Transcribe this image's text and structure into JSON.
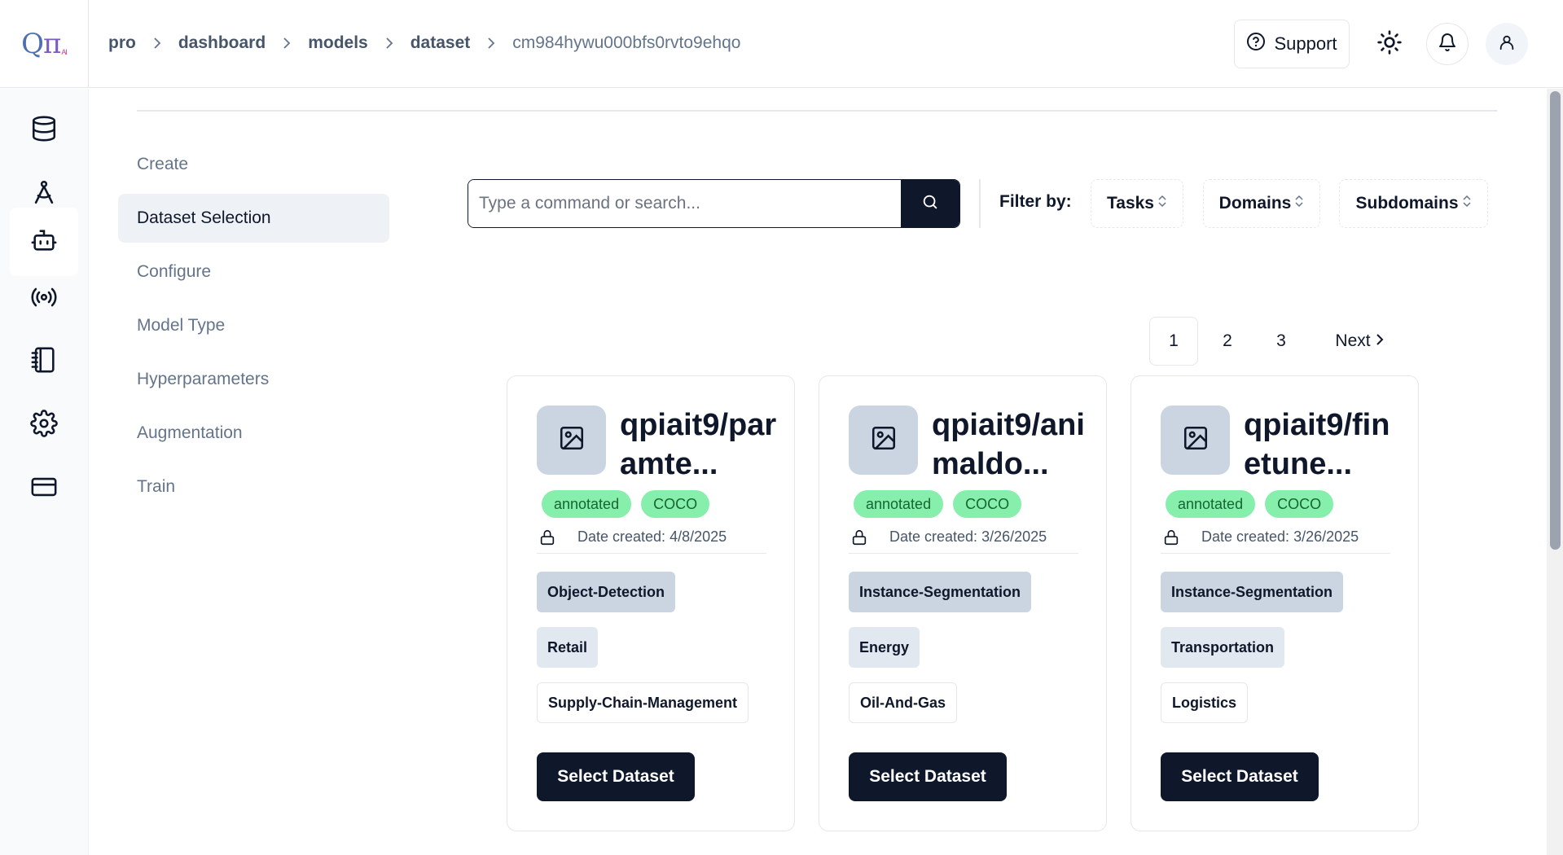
{
  "header": {
    "logo": {
      "main": "Q",
      "pi": "π",
      "suffix": "AI"
    },
    "breadcrumb": [
      "pro",
      "dashboard",
      "models",
      "dataset",
      "cm984hywu000bfs0rvto9ehqo"
    ],
    "support_label": "Support"
  },
  "sidebar_icons": [
    "database-icon",
    "compass-icon",
    "bot-icon",
    "radio-icon",
    "notebook-icon",
    "settings-icon",
    "credit-card-icon"
  ],
  "steps": {
    "items": [
      "Create",
      "Dataset Selection",
      "Configure",
      "Model Type",
      "Hyperparameters",
      "Augmentation",
      "Train"
    ],
    "active": "Dataset Selection"
  },
  "search": {
    "placeholder": "Type a command or search..."
  },
  "filters": {
    "label": "Filter by:",
    "tasks": "Tasks",
    "domains": "Domains",
    "subdomains": "Subdomains"
  },
  "pagination": {
    "pages": [
      "1",
      "2",
      "3"
    ],
    "current": "1",
    "next": "Next"
  },
  "cards": [
    {
      "title": "qpiait9/paramte...",
      "badges": [
        "annotated",
        "COCO"
      ],
      "date": "Date created: 4/8/2025",
      "tags": [
        "Object-Detection",
        "Retail",
        "Supply-Chain-Management"
      ],
      "button": "Select Dataset"
    },
    {
      "title": "qpiait9/animaldo...",
      "badges": [
        "annotated",
        "COCO"
      ],
      "date": "Date created: 3/26/2025",
      "tags": [
        "Instance-Segmentation",
        "Energy",
        "Oil-And-Gas"
      ],
      "button": "Select Dataset"
    },
    {
      "title": "qpiait9/finetune...",
      "badges": [
        "annotated",
        "COCO"
      ],
      "date": "Date created: 3/26/2025",
      "tags": [
        "Instance-Segmentation",
        "Transportation",
        "Logistics"
      ],
      "button": "Select Dataset"
    }
  ],
  "colors": {
    "primary": "#0f172a",
    "badge_bg": "#86efac",
    "badge_text": "#166534",
    "tag_primary": "#cbd5e1"
  }
}
